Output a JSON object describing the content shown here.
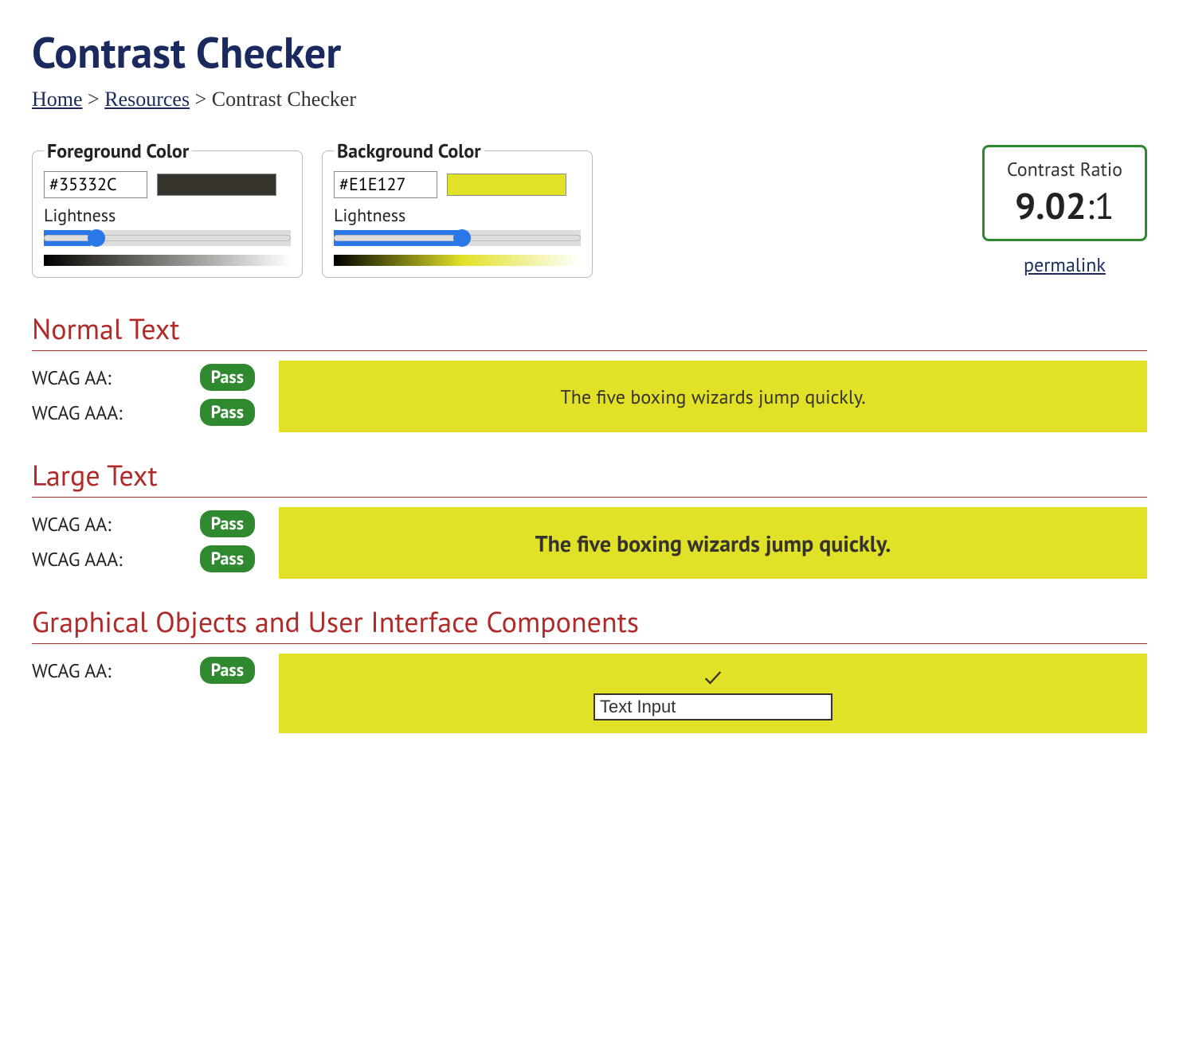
{
  "title": "Contrast Checker",
  "breadcrumb": {
    "home": "Home",
    "resources": "Resources",
    "current": "Contrast Checker"
  },
  "foreground": {
    "legend": "Foreground Color",
    "hex": "#35332C",
    "lightness_label": "Lightness",
    "lightness_value": 19
  },
  "background": {
    "legend": "Background Color",
    "hex": "#E1E127",
    "lightness_label": "Lightness",
    "lightness_value": 52
  },
  "ratio": {
    "label": "Contrast Ratio",
    "value": "9.02",
    "suffix": ":1",
    "permalink": "permalink"
  },
  "sections": {
    "normal": {
      "heading": "Normal Text",
      "aa_label": "WCAG AA:",
      "aa_result": "Pass",
      "aaa_label": "WCAG AAA:",
      "aaa_result": "Pass",
      "sample": "The five boxing wizards jump quickly."
    },
    "large": {
      "heading": "Large Text",
      "aa_label": "WCAG AA:",
      "aa_result": "Pass",
      "aaa_label": "WCAG AAA:",
      "aaa_result": "Pass",
      "sample": "The five boxing wizards jump quickly."
    },
    "ui": {
      "heading": "Graphical Objects and User Interface Components",
      "aa_label": "WCAG AA:",
      "aa_result": "Pass",
      "input_value": "Text Input"
    }
  }
}
